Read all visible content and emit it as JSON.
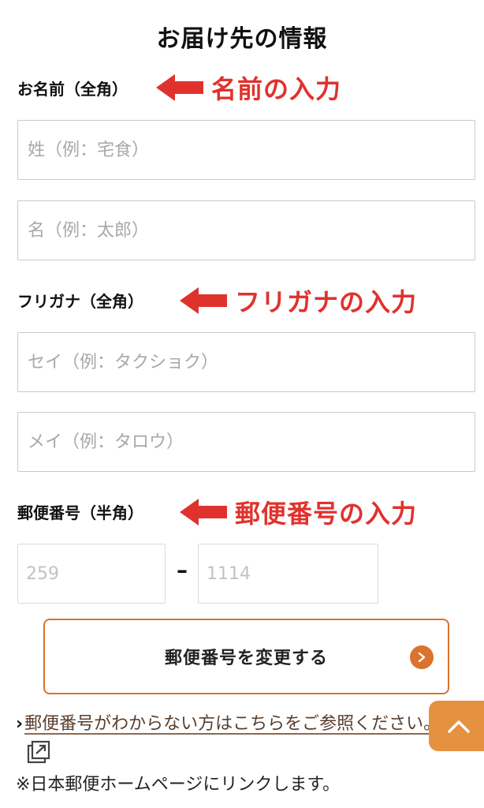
{
  "page": {
    "title": "お届け先の情報"
  },
  "name_section": {
    "label": "お名前（全角）",
    "annotation": "名前の入力",
    "last_name_placeholder": "姓（例：宅食）",
    "first_name_placeholder": "名（例：太郎）"
  },
  "kana_section": {
    "label": "フリガナ（全角）",
    "annotation": "フリガナの入力",
    "last_name_placeholder": "セイ（例：タクショク）",
    "first_name_placeholder": "メイ（例：タロウ）"
  },
  "zip_section": {
    "label": "郵便番号（半角）",
    "annotation": "郵便番号の入力",
    "zip1_placeholder": "259",
    "zip_separator": "–",
    "zip2_placeholder": "1114",
    "change_button_label": "郵便番号を変更する"
  },
  "help": {
    "chevron": "›",
    "link_text": "郵便番号がわからない方はこちらをご参照ください。",
    "note": "※日本郵便ホームページにリンクします。"
  },
  "icons": {
    "annotation_arrow": "arrow-left-icon",
    "button_chevron": "chevron-right-icon",
    "external_link": "external-link-icon",
    "scroll_top": "chevron-up-icon"
  },
  "colors": {
    "annotation_red": "#e0322d",
    "accent_orange": "#d9732e",
    "scroll_button": "#e49140"
  }
}
